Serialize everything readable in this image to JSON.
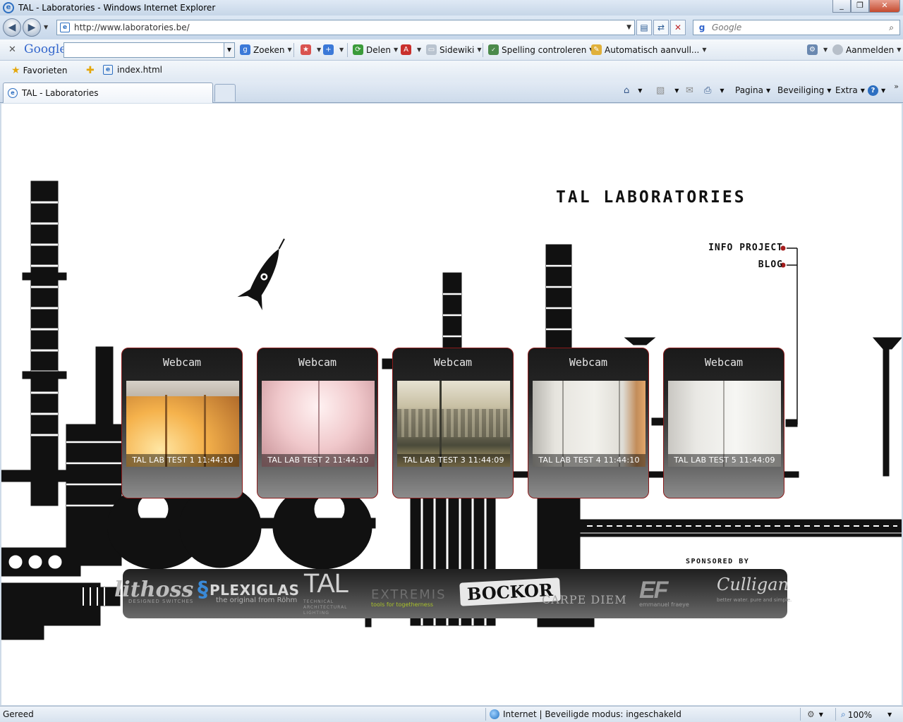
{
  "window": {
    "title": "TAL - Laboratories - Windows Internet Explorer",
    "controls": [
      "_",
      "❐",
      "✕"
    ]
  },
  "address": {
    "url": "http://www.laboratories.be/",
    "search_placeholder": "Google"
  },
  "google_toolbar": {
    "logo": "Google",
    "items": {
      "zoeken": "Zoeken",
      "delen": "Delen",
      "sidewiki": "Sidewiki",
      "spelling": "Spelling controleren",
      "autofill": "Automatisch aanvull...",
      "aanmelden": "Aanmelden"
    }
  },
  "favorites": {
    "label": "Favorieten",
    "items": [
      "index.html"
    ]
  },
  "tabs": [
    {
      "label": "TAL - Laboratories"
    }
  ],
  "command_bar": {
    "pagina": "Pagina",
    "beveiliging": "Beveiliging",
    "extra": "Extra"
  },
  "page": {
    "site_title": "TAL LABORATORIES",
    "nav": [
      "INFO PROJECT",
      "BLOG"
    ],
    "webcams": [
      {
        "title": "Webcam",
        "caption": "TAL LAB TEST 1  11:44:10"
      },
      {
        "title": "Webcam",
        "caption": "TAL LAB TEST 2  11:44:10"
      },
      {
        "title": "Webcam",
        "caption": "TAL LAB TEST 3  11:44:09"
      },
      {
        "title": "Webcam",
        "caption": "TAL LAB TEST 4  11:44:10"
      },
      {
        "title": "Webcam",
        "caption": "TAL LAB TEST 5  11:44:09"
      }
    ],
    "sponsored_label": "SPONSORED BY",
    "sponsors": {
      "lithoss": "lithoss",
      "lithoss_sub": "DESIGNED SWITCHES",
      "plexiglas": "PLEXIGLAS",
      "plexiglas_sub": "the original from Röhm",
      "tal": "TAL",
      "tal_sub": "TECHNICAL ARCHITECTURAL LIGHTING",
      "extremis": "EXTREMIS",
      "extremis_sub": "tools for togetherness",
      "bockor": "BOCKOR",
      "carpe": "CARPE DIEM",
      "ef": "EF",
      "ef_sub": "emmanuel fraeye",
      "culligan": "Culligan",
      "culligan_sub": "better water. pure and simple."
    }
  },
  "status": {
    "left": "Gereed",
    "zone": "Internet | Beveiligde modus: ingeschakeld",
    "zoom": "100%"
  }
}
